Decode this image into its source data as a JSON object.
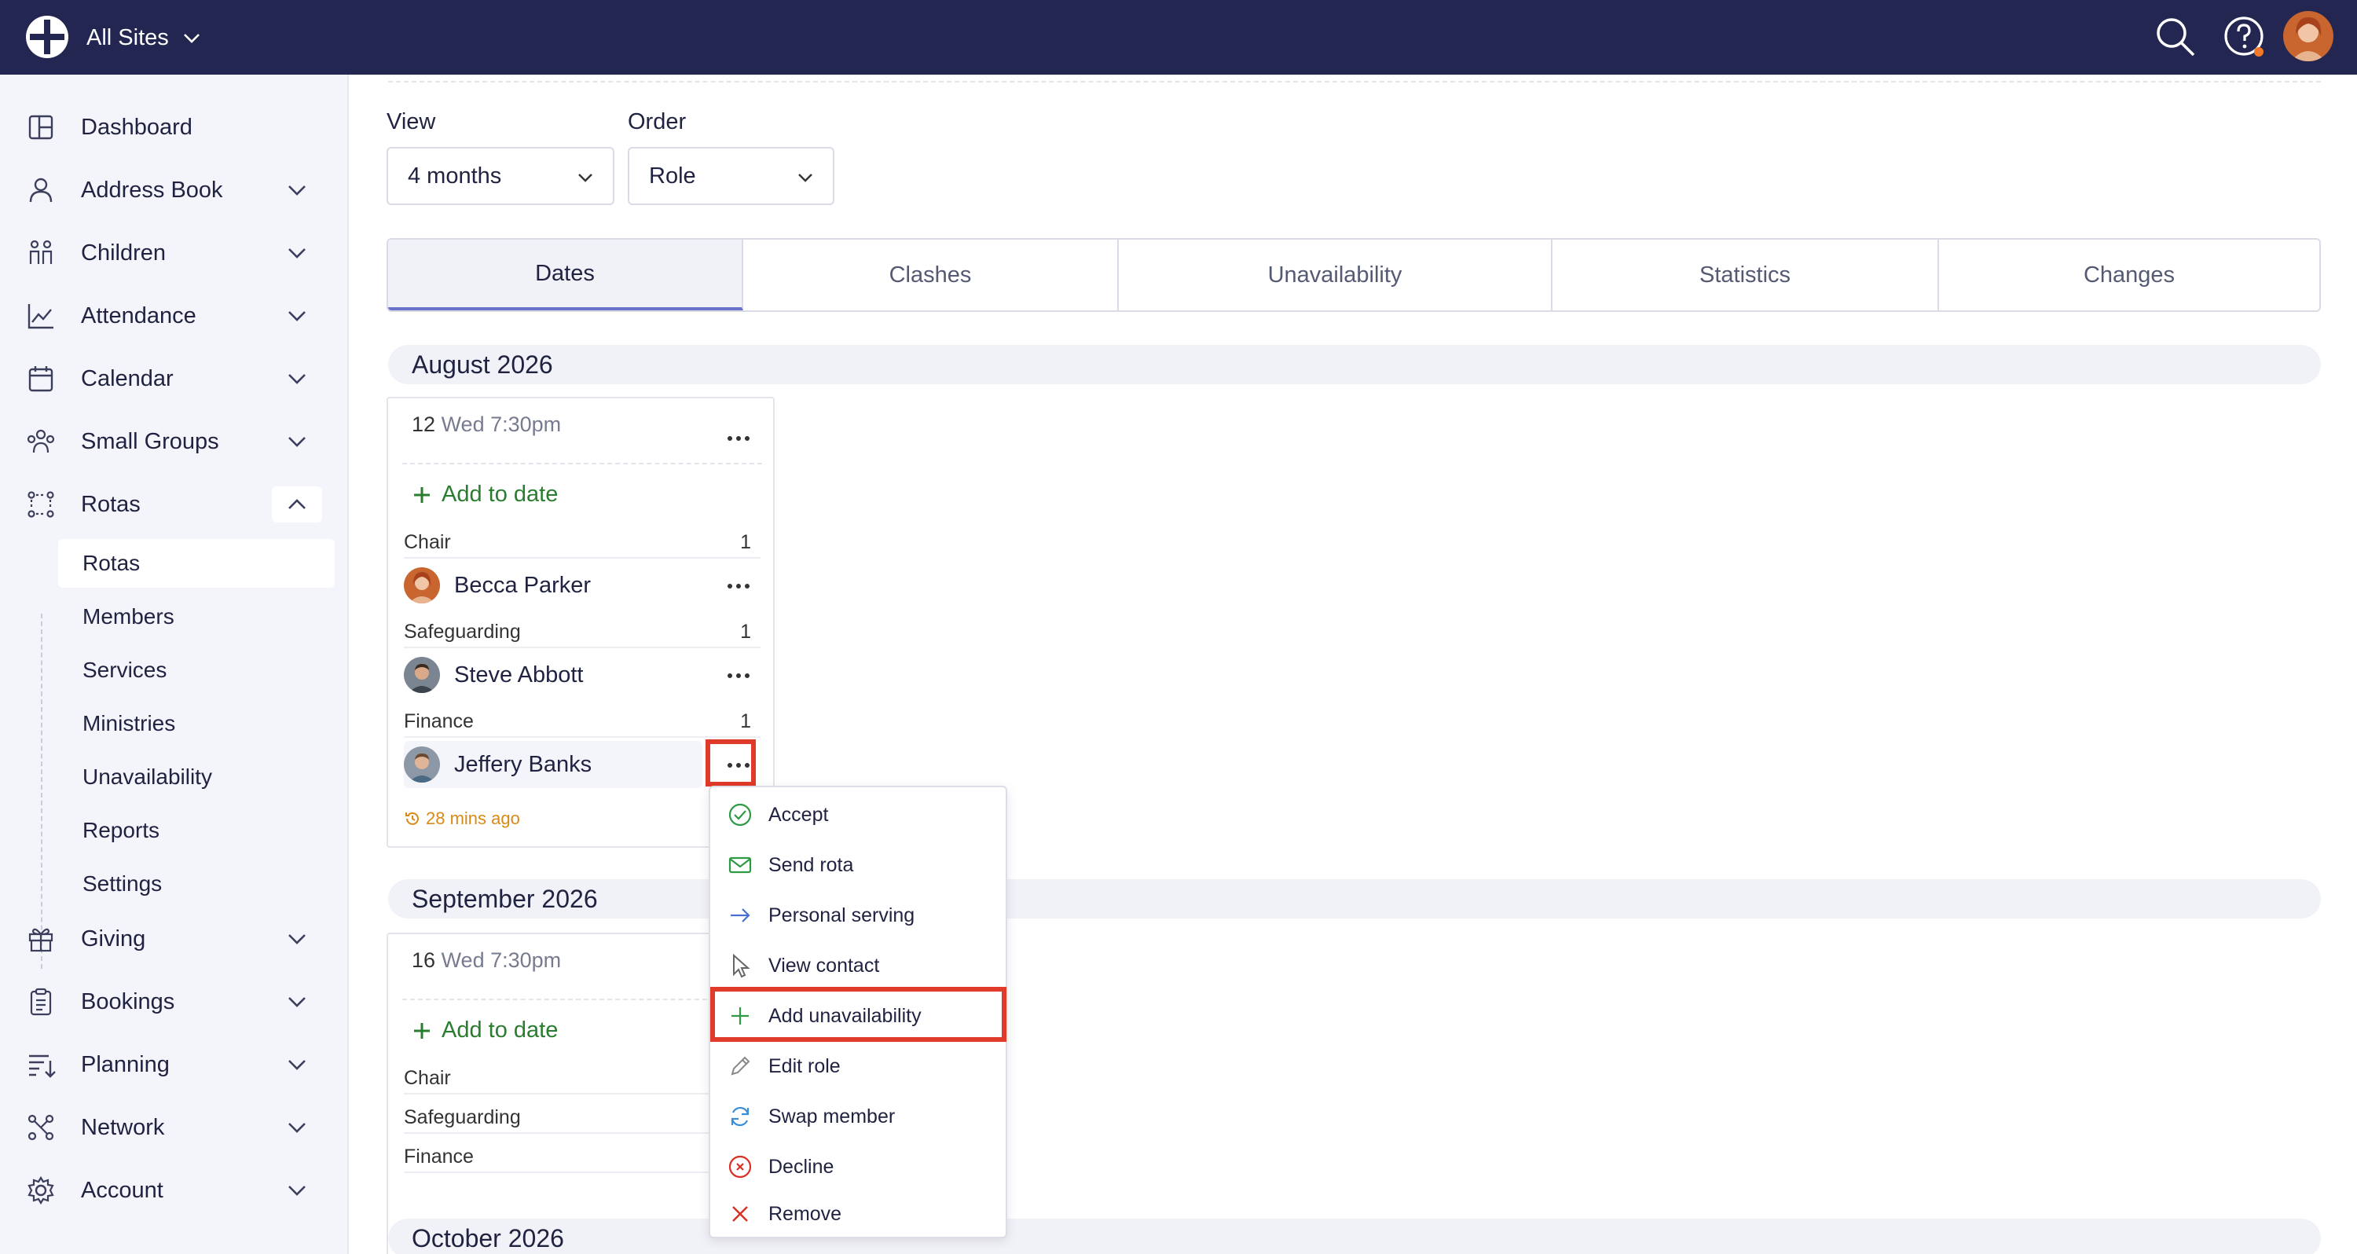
{
  "header": {
    "site_switcher": "All Sites"
  },
  "sidebar": {
    "items": [
      {
        "label": "Dashboard"
      },
      {
        "label": "Address Book"
      },
      {
        "label": "Children"
      },
      {
        "label": "Attendance"
      },
      {
        "label": "Calendar"
      },
      {
        "label": "Small Groups"
      },
      {
        "label": "Rotas"
      },
      {
        "label": "Giving"
      },
      {
        "label": "Bookings"
      },
      {
        "label": "Planning"
      },
      {
        "label": "Network"
      },
      {
        "label": "Account"
      }
    ],
    "rotas_sub": [
      "Rotas",
      "Members",
      "Services",
      "Ministries",
      "Unavailability",
      "Reports",
      "Settings"
    ]
  },
  "filters": {
    "view_label": "View",
    "view_value": "4 months",
    "order_label": "Order",
    "order_value": "Role"
  },
  "tabs": [
    "Dates",
    "Clashes",
    "Unavailability",
    "Statistics",
    "Changes"
  ],
  "months": [
    "August 2026",
    "September 2026",
    "October 2026"
  ],
  "card1": {
    "day": "12",
    "when": "Wed 7:30pm",
    "add_label": "Add to date",
    "roles": [
      {
        "role": "Chair",
        "count": "1",
        "member": "Becca Parker"
      },
      {
        "role": "Safeguarding",
        "count": "1",
        "member": "Steve Abbott"
      },
      {
        "role": "Finance",
        "count": "1",
        "member": "Jeffery Banks"
      }
    ],
    "updated": "28 mins ago"
  },
  "card2": {
    "day": "16",
    "when": "Wed 7:30pm",
    "add_label": "Add to date",
    "roles": [
      "Chair",
      "Safeguarding",
      "Finance"
    ]
  },
  "menu": [
    "Accept",
    "Send rota",
    "Personal serving",
    "View contact",
    "Add unavailability",
    "Edit role",
    "Swap member",
    "Decline",
    "Remove"
  ],
  "colors": {
    "topbar": "#222650",
    "accent_green": "#2a7d2e",
    "highlight_red": "#e03a2a",
    "pending_orange": "#d98a16"
  }
}
